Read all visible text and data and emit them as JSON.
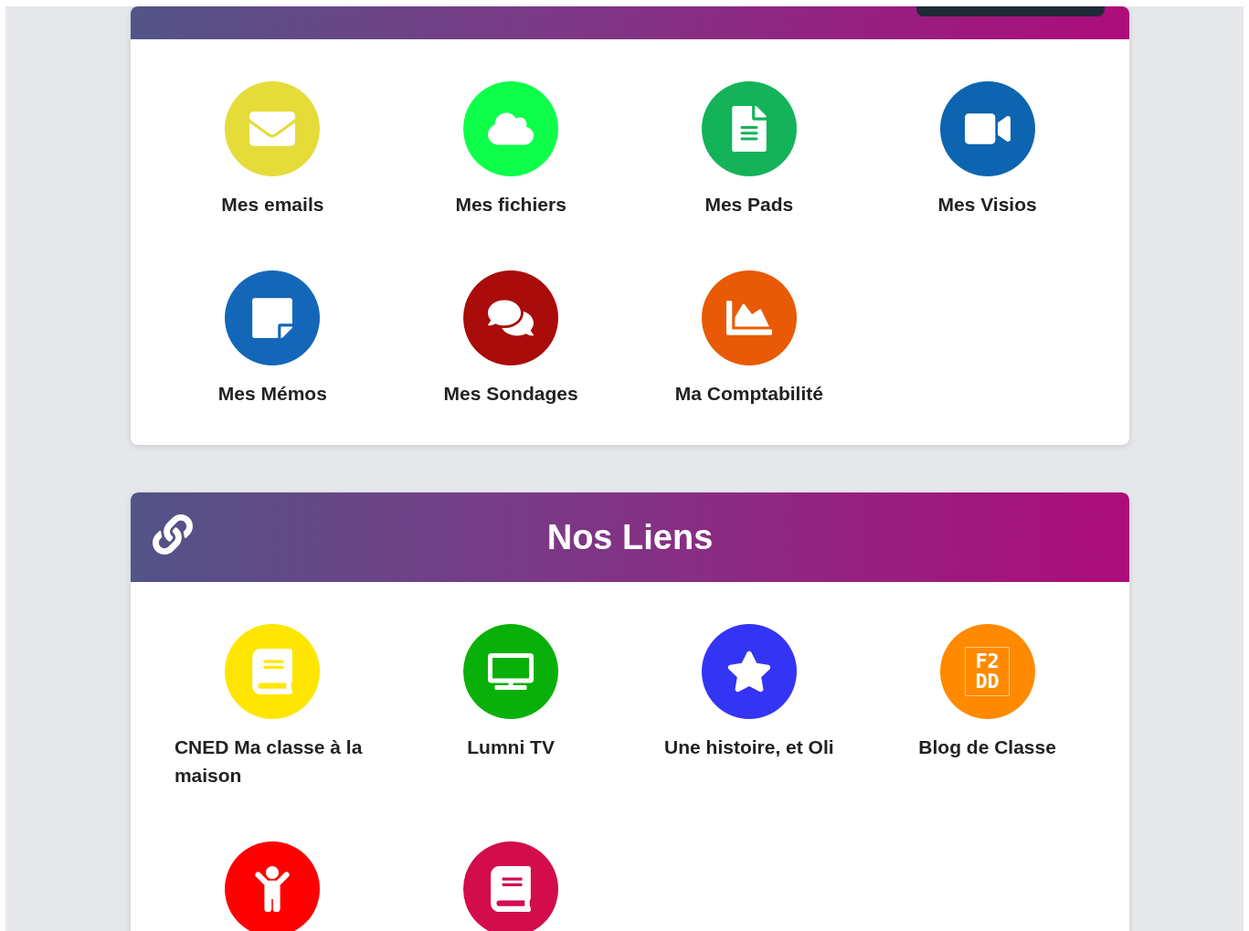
{
  "sections": [
    {
      "kind": "cut",
      "items": [
        {
          "kind": "mail",
          "label": "Mes emails",
          "color": "#e5dc3a"
        },
        {
          "kind": "cloud",
          "label": "Mes fichiers",
          "color": "#0dff4a"
        },
        {
          "kind": "document",
          "label": "Mes Pads",
          "color": "#14b35a"
        },
        {
          "kind": "video",
          "label": "Mes Visios",
          "color": "#0d64b0"
        },
        {
          "kind": "note",
          "label": "Mes Mémos",
          "color": "#1467b8"
        },
        {
          "kind": "chat",
          "label": "Mes Sondages",
          "color": "#aa0b0b"
        },
        {
          "kind": "chart",
          "label": "Ma Comptabilité",
          "color": "#e85a05"
        }
      ]
    },
    {
      "kind": "full",
      "title": "Nos Liens",
      "items": [
        {
          "kind": "book",
          "label": "CNED Ma classe à la maison",
          "color": "#ffe600"
        },
        {
          "kind": "tv",
          "label": "Lumni TV",
          "color": "#0ab00a"
        },
        {
          "kind": "star",
          "label": "Une histoire, et Oli",
          "color": "#3434f5"
        },
        {
          "kind": "logo",
          "label": "Blog de Classe",
          "color": "#ff8a00",
          "logo": [
            "F2",
            "DD"
          ]
        },
        {
          "kind": "child",
          "color": "#ff0000"
        },
        {
          "kind": "book2",
          "color": "#d30c4c"
        }
      ]
    }
  ]
}
